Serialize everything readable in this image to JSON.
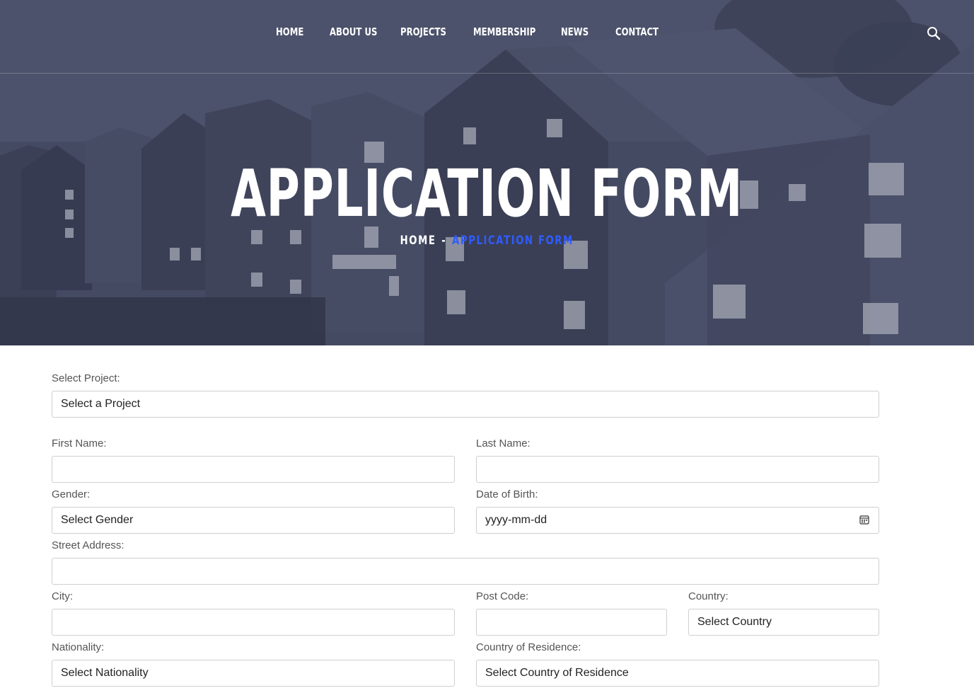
{
  "nav": {
    "items": [
      "HOME",
      "ABOUT US",
      "PROJECTS",
      "MEMBERSHIP",
      "NEWS",
      "CONTACT"
    ]
  },
  "hero": {
    "title": "APPLICATION FORM",
    "breadcrumb": {
      "home": "HOME",
      "separator": "-",
      "current": "APPLICATION FORM"
    }
  },
  "form": {
    "project": {
      "label": "Select Project:",
      "value": "Select a Project"
    },
    "first_name": {
      "label": "First Name:",
      "value": ""
    },
    "last_name": {
      "label": "Last Name:",
      "value": ""
    },
    "gender": {
      "label": "Gender:",
      "value": "Select Gender"
    },
    "dob": {
      "label": "Date of Birth:",
      "value": "yyyy-mm-dd"
    },
    "street": {
      "label": "Street Address:",
      "value": ""
    },
    "city": {
      "label": "City:",
      "value": ""
    },
    "post_code": {
      "label": "Post Code:",
      "value": ""
    },
    "country": {
      "label": "Country:",
      "value": "Select Country"
    },
    "nationality": {
      "label": "Nationality:",
      "value": "Select Nationality"
    },
    "residence": {
      "label": "Country of Residence:",
      "value": "Select Country of Residence"
    }
  },
  "colors": {
    "accent": "#2f5cff",
    "hero_overlay": "#454b63"
  },
  "icons": {
    "search": "search-icon",
    "calendar": "calendar-icon"
  }
}
